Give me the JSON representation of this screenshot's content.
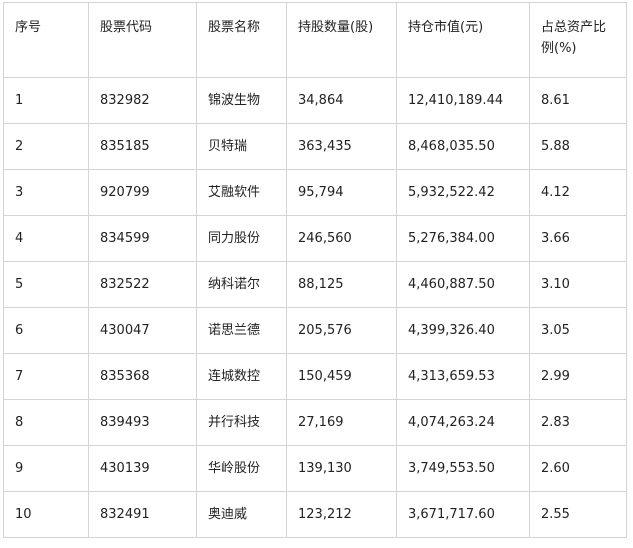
{
  "table": {
    "headers": {
      "index": "序号",
      "code": "股票代码",
      "name": "股票名称",
      "shares": "持股数量(股)",
      "value": "持仓市值(元)",
      "ratio": "占总资产比例(%)"
    },
    "rows": [
      {
        "index": "1",
        "code": "832982",
        "name": "锦波生物",
        "shares": "34,864",
        "value": "12,410,189.44",
        "ratio": "8.61"
      },
      {
        "index": "2",
        "code": "835185",
        "name": "贝特瑞",
        "shares": "363,435",
        "value": "8,468,035.50",
        "ratio": "5.88"
      },
      {
        "index": "3",
        "code": "920799",
        "name": "艾融软件",
        "shares": "95,794",
        "value": "5,932,522.42",
        "ratio": "4.12"
      },
      {
        "index": "4",
        "code": "834599",
        "name": "同力股份",
        "shares": "246,560",
        "value": "5,276,384.00",
        "ratio": "3.66"
      },
      {
        "index": "5",
        "code": "832522",
        "name": "纳科诺尔",
        "shares": "88,125",
        "value": "4,460,887.50",
        "ratio": "3.10"
      },
      {
        "index": "6",
        "code": "430047",
        "name": "诺思兰德",
        "shares": "205,576",
        "value": "4,399,326.40",
        "ratio": "3.05"
      },
      {
        "index": "7",
        "code": "835368",
        "name": "连城数控",
        "shares": "150,459",
        "value": "4,313,659.53",
        "ratio": "2.99"
      },
      {
        "index": "8",
        "code": "839493",
        "name": "并行科技",
        "shares": "27,169",
        "value": "4,074,263.24",
        "ratio": "2.83"
      },
      {
        "index": "9",
        "code": "430139",
        "name": "华岭股份",
        "shares": "139,130",
        "value": "3,749,553.50",
        "ratio": "2.60"
      },
      {
        "index": "10",
        "code": "832491",
        "name": "奥迪威",
        "shares": "123,212",
        "value": "3,671,717.60",
        "ratio": "2.55"
      }
    ]
  }
}
